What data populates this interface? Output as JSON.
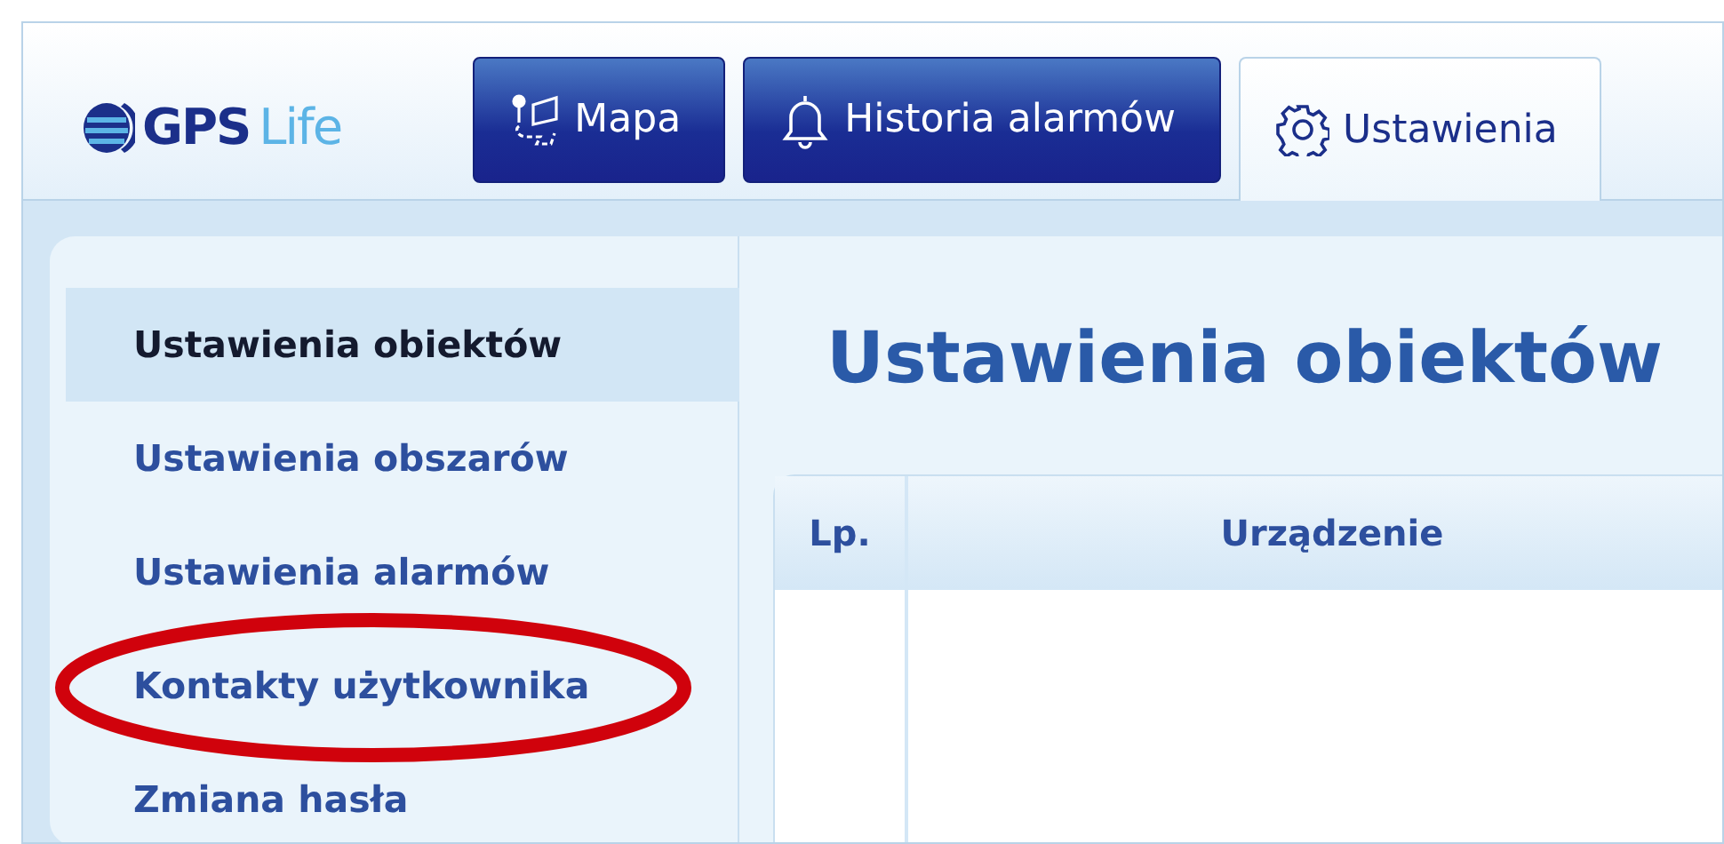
{
  "brand": {
    "primary": "GPS",
    "secondary": "Life"
  },
  "tabs": [
    {
      "label": "Mapa",
      "selected": false
    },
    {
      "label": "Historia alarmów",
      "selected": false
    },
    {
      "label": "Ustawienia",
      "selected": true
    }
  ],
  "sidebar": {
    "items": [
      {
        "label": "Ustawienia obiektów",
        "selected": true,
        "highlighted": false
      },
      {
        "label": "Ustawienia obszarów",
        "selected": false,
        "highlighted": false
      },
      {
        "label": "Ustawienia alarmów",
        "selected": false,
        "highlighted": false
      },
      {
        "label": "Kontakty użytkownika",
        "selected": false,
        "highlighted": true
      },
      {
        "label": "Zmiana hasła",
        "selected": false,
        "highlighted": false
      }
    ]
  },
  "content": {
    "title": "Ustawienia obiektów",
    "table": {
      "columns": [
        "Lp.",
        "Urządzenie"
      ]
    }
  }
}
